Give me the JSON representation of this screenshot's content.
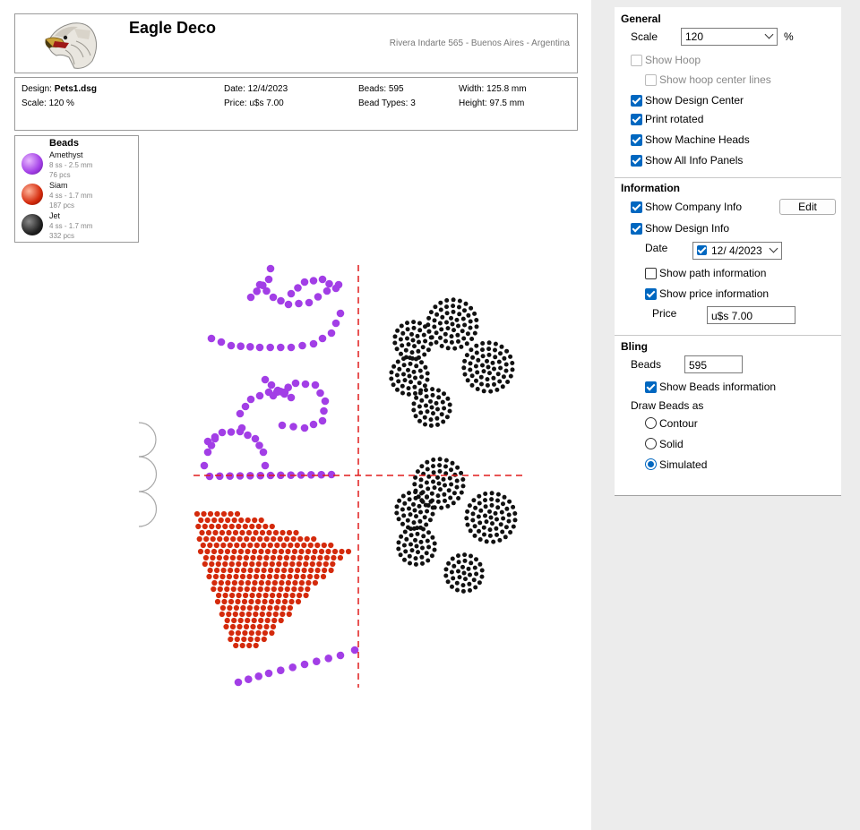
{
  "company": {
    "name": "Eagle Deco",
    "address": "Rivera Indarte 565 - Buenos Aires - Argentina"
  },
  "design_info": {
    "design_label": "Design:",
    "design_value": "Pets1.dsg",
    "scale": "Scale: 120 %",
    "date": "Date: 12/4/2023",
    "price": "Price: u$s 7.00",
    "beads": "Beads: 595",
    "bead_types": "Bead Types: 3",
    "width": "Width: 125.8 mm",
    "height": "Height: 97.5 mm"
  },
  "beads_panel": {
    "title": "Beads",
    "items": [
      {
        "name": "Amethyst",
        "size": "8 ss - 2.5 mm",
        "count": "76 pcs",
        "color": "#a23ee6"
      },
      {
        "name": "Siam",
        "size": "4 ss - 1.7 mm",
        "count": "187 pcs",
        "color": "#d42a0c"
      },
      {
        "name": "Jet",
        "size": "4 ss - 1.7 mm",
        "count": "332 pcs",
        "color": "#1a1a1a"
      }
    ]
  },
  "colors": {
    "amethyst": "#a23ee6",
    "siam": "#d42a0c",
    "jet": "#111111",
    "center_line": "#e11b1b",
    "accent": "#0067c0"
  },
  "settings": {
    "general": {
      "title": "General",
      "scale_label": "Scale",
      "scale_value": "120",
      "scale_unit": "%",
      "show_hoop": "Show Hoop",
      "show_hoop_center": "Show hoop center lines",
      "show_design_center": "Show Design Center",
      "print_rotated": "Print rotated",
      "show_machine_heads": "Show Machine Heads",
      "show_all_info": "Show All Info Panels"
    },
    "information": {
      "title": "Information",
      "show_company": "Show Company Info",
      "edit_label": "Edit",
      "show_design_info": "Show Design Info",
      "date_label": "Date",
      "date_value": "12/  4/2023",
      "show_path": "Show path information",
      "show_price": "Show price information",
      "price_label": "Price",
      "price_value": "u$s 7.00"
    },
    "bling": {
      "title": "Bling",
      "beads_label": "Beads",
      "beads_value": "595",
      "show_beads_info": "Show Beads information",
      "draw_as_label": "Draw Beads as",
      "contour": "Contour",
      "solid": "Solid",
      "simulated": "Simulated"
    }
  }
}
